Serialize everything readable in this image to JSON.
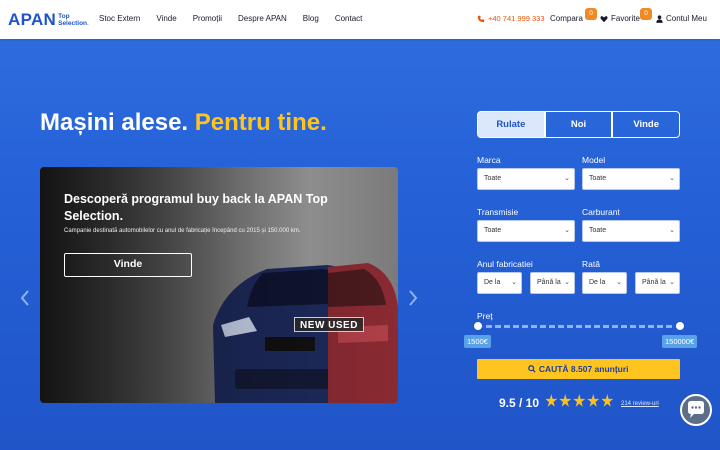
{
  "header": {
    "logo_main": "APAN",
    "logo_sub_line1": "Top",
    "logo_sub_line2": "Selection",
    "nav": [
      "Stoc Extern",
      "Vinde",
      "Promoții",
      "Despre APAN",
      "Blog",
      "Contact"
    ],
    "phone": "+40 741 999 333",
    "compara_label": "Compara",
    "compara_count": "0",
    "favorite_label": "Favorite",
    "favorite_count": "0",
    "account_label": "Contul Meu"
  },
  "hero": {
    "title_part1": "Mașini alese.",
    "title_part2": "Pentru tine."
  },
  "slide": {
    "heading": "Descoperă programul buy back la APAN Top Selection.",
    "text": "Campanie destinată automobilelor cu anul de fabricație începând cu 2015 și 150.000 km.",
    "button": "Vinde",
    "overlay_label": "NEW USED"
  },
  "search": {
    "tabs": [
      "Rulate",
      "Noi",
      "Vinde"
    ],
    "active_tab": "Rulate",
    "marca_label": "Marca",
    "marca_value": "Toate",
    "model_label": "Model",
    "model_value": "Toate",
    "transmisie_label": "Transmisie",
    "transmisie_value": "Toate",
    "carburant_label": "Carburant",
    "carburant_value": "Toate",
    "an_label": "Anul fabricatiei",
    "an_from": "De la",
    "an_to": "Până la",
    "rata_label": "Rată",
    "rata_from": "De la",
    "rata_to": "Până la",
    "pret_label": "Preț",
    "pret_min": "1500€",
    "pret_max": "150000€",
    "search_button": "CAUTĂ 8.507 anunțuri"
  },
  "rating": {
    "score": "9.5 / 10",
    "stars": 5,
    "reviews": "214 review-uri"
  },
  "colors": {
    "brand_blue": "#1f55c8",
    "accent_yellow": "#ffc41f",
    "phone_orange": "#e8540c",
    "badge_orange": "#f08a24"
  }
}
